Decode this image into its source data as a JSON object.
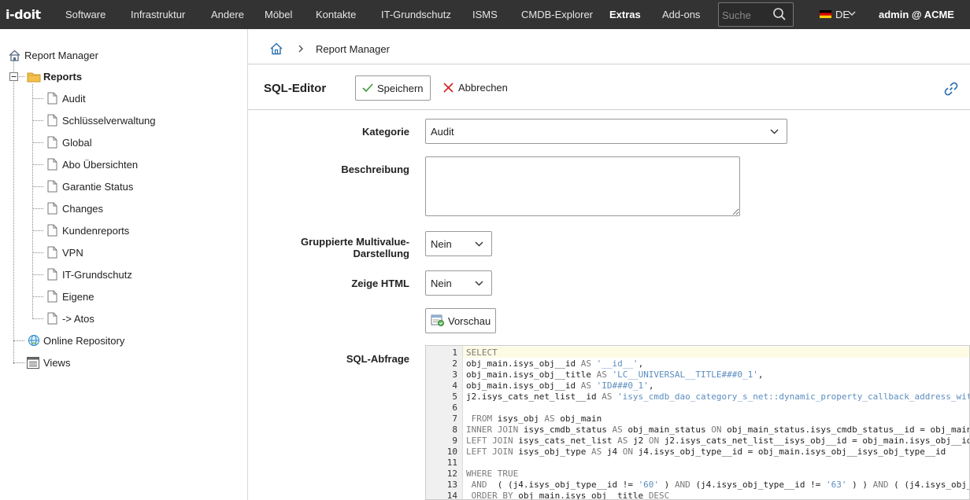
{
  "topbar": {
    "logo": "i-doit",
    "nav": [
      "Software",
      "Infrastruktur",
      "Andere",
      "Möbel",
      "Kontakte",
      "IT-Grundschutz",
      "ISMS",
      "CMDB-Explorer",
      "Extras",
      "Add-ons"
    ],
    "active_nav": "Extras",
    "search_placeholder": "Suche",
    "language": "DE",
    "user": "admin @ ACME"
  },
  "sidebar": {
    "root": "Report Manager",
    "reports_folder": "Reports",
    "reports": [
      "Audit",
      "Schlüsselverwaltung",
      "Global",
      "Abo Übersichten",
      "Garantie Status",
      "Changes",
      "Kundenreports",
      "VPN",
      "IT-Grundschutz",
      "Eigene",
      "-> Atos"
    ],
    "online_repository": "Online Repository",
    "views": "Views"
  },
  "breadcrumb": {
    "current": "Report Manager"
  },
  "toolbar": {
    "title": "SQL-Editor",
    "save_label": "Speichern",
    "cancel_label": "Abbrechen"
  },
  "form": {
    "kategorie_label": "Kategorie",
    "kategorie_value": "Audit",
    "beschreibung_label": "Beschreibung",
    "beschreibung_value": "",
    "gruppiert_label_line1": "Gruppierte Multivalue-",
    "gruppiert_label_line2": "Darstellung",
    "gruppiert_value": "Nein",
    "html_label": "Zeige HTML",
    "html_value": "Nein",
    "preview_label": "Vorschau",
    "sql_label": "SQL-Abfrage"
  },
  "sql": {
    "lines": [
      [
        [
          "kw",
          "SELECT"
        ]
      ],
      [
        [
          "",
          "obj_main.isys_obj__id "
        ],
        [
          "kw",
          "AS "
        ],
        [
          "str",
          "'__id__'"
        ],
        [
          "",
          ","
        ]
      ],
      [
        [
          "",
          "obj_main.isys_obj__title "
        ],
        [
          "kw",
          "AS "
        ],
        [
          "str",
          "'LC__UNIVERSAL__TITLE###0_1'"
        ],
        [
          "",
          ","
        ]
      ],
      [
        [
          "",
          "obj_main.isys_obj__id "
        ],
        [
          "kw",
          "AS "
        ],
        [
          "str",
          "'ID###0_1'"
        ],
        [
          "",
          ","
        ]
      ],
      [
        [
          "",
          "j2.isys_cats_net_list__id "
        ],
        [
          "kw",
          "AS "
        ],
        [
          "str",
          "'isys_cmdb_dao_category_s_net::dynamic_property_callback_address_wit"
        ]
      ],
      [
        [
          "",
          ""
        ]
      ],
      [
        [
          "kw",
          " FROM "
        ],
        [
          "",
          "isys_obj "
        ],
        [
          "kw",
          "AS "
        ],
        [
          "",
          "obj_main"
        ]
      ],
      [
        [
          "kw",
          "INNER JOIN "
        ],
        [
          "",
          "isys_cmdb_status "
        ],
        [
          "kw",
          "AS "
        ],
        [
          "",
          "obj_main_status "
        ],
        [
          "kw",
          "ON "
        ],
        [
          "",
          "obj_main_status.isys_cmdb_status__id = obj_main"
        ]
      ],
      [
        [
          "kw",
          "LEFT JOIN "
        ],
        [
          "",
          "isys_cats_net_list "
        ],
        [
          "kw",
          "AS "
        ],
        [
          "",
          "j2 "
        ],
        [
          "kw",
          "ON "
        ],
        [
          "",
          "j2.isys_cats_net_list__isys_obj__id = obj_main.isys_obj__id"
        ]
      ],
      [
        [
          "kw",
          "LEFT JOIN "
        ],
        [
          "",
          "isys_obj_type "
        ],
        [
          "kw",
          "AS "
        ],
        [
          "",
          "j4 "
        ],
        [
          "kw",
          "ON "
        ],
        [
          "",
          "j4.isys_obj_type__id = obj_main.isys_obj__isys_obj_type__id"
        ]
      ],
      [
        [
          "",
          ""
        ]
      ],
      [
        [
          "kw",
          "WHERE TRUE"
        ]
      ],
      [
        [
          "kw",
          " AND  "
        ],
        [
          "",
          "( (j4.isys_obj_type__id != "
        ],
        [
          "str",
          "'60'"
        ],
        [
          "",
          " ) "
        ],
        [
          "kw",
          "AND "
        ],
        [
          "",
          "(j4.isys_obj_type__id != "
        ],
        [
          "str",
          "'63'"
        ],
        [
          "",
          " ) ) "
        ],
        [
          "kw",
          "AND "
        ],
        [
          "",
          "( (j4.isys_obj_"
        ]
      ],
      [
        [
          "kw",
          " ORDER BY "
        ],
        [
          "",
          "obj_main.isys_obj__title "
        ],
        [
          "kw",
          "DESC"
        ]
      ]
    ]
  }
}
